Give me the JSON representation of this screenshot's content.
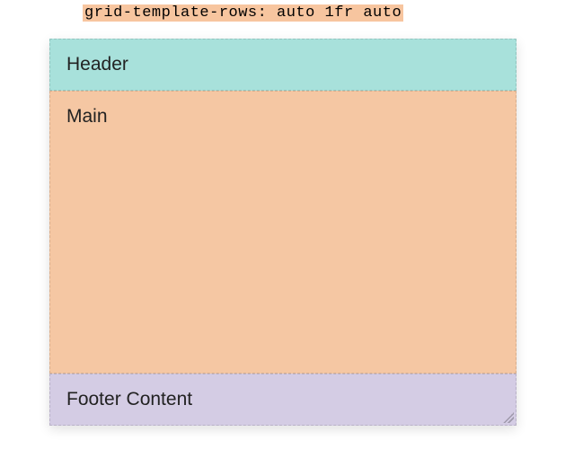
{
  "code_label": "grid-template-rows: auto 1fr auto",
  "rows": {
    "header": "Header",
    "main": "Main",
    "footer": "Footer Content"
  }
}
